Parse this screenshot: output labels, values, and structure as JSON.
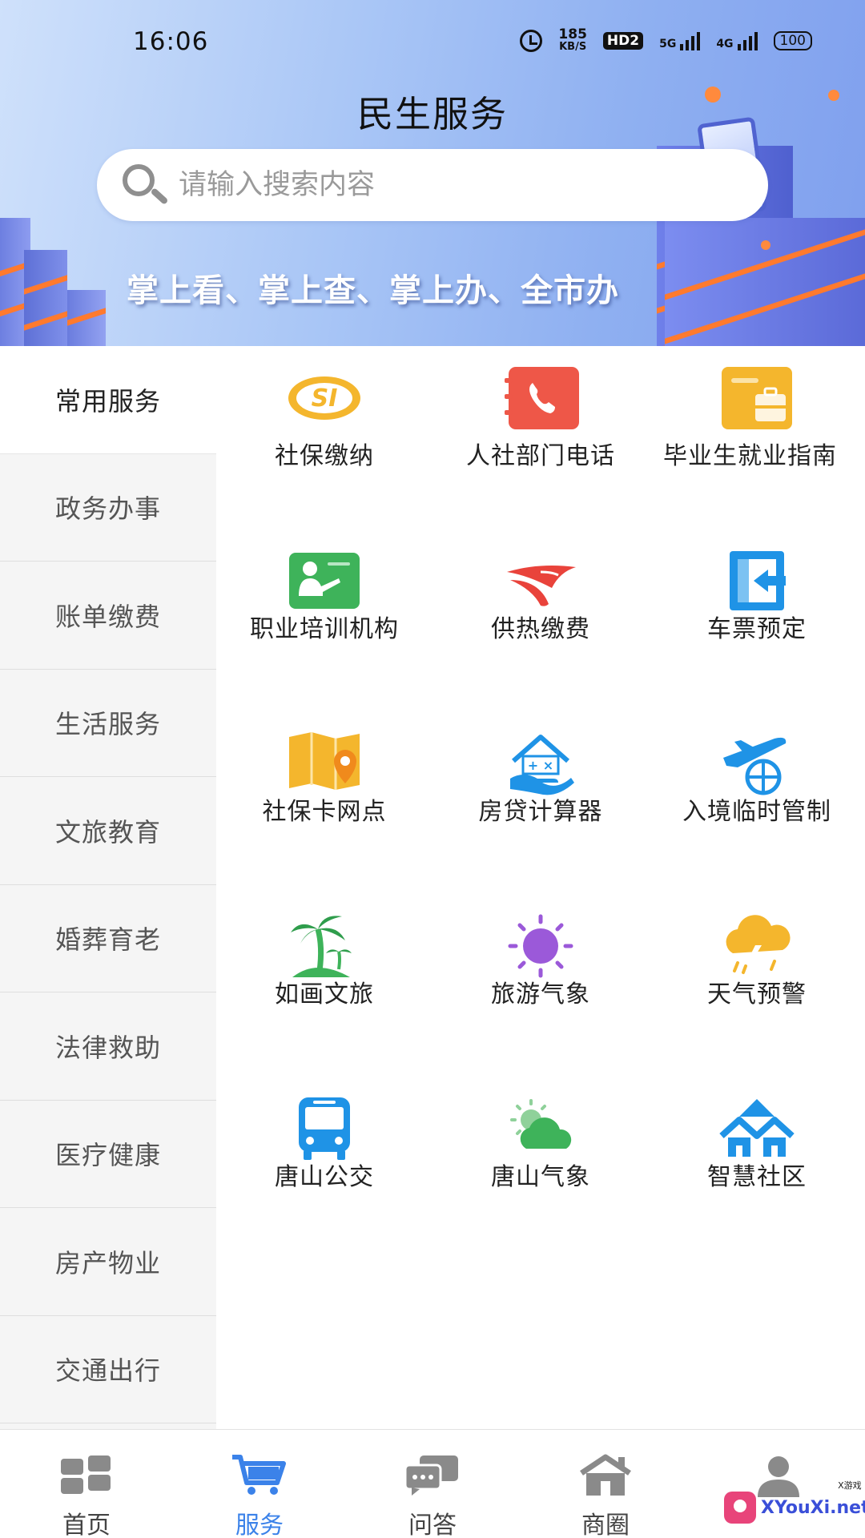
{
  "status_bar": {
    "time": "16:06",
    "speed_value": "185",
    "speed_unit": "KB/S",
    "hd_label": "HD2",
    "net1": "5G",
    "net2": "4G",
    "battery": "100"
  },
  "header": {
    "title": "民生服务",
    "search_placeholder": "请输入搜索内容",
    "slogan": "掌上看、掌上查、掌上办、全市办"
  },
  "sidebar": {
    "items": [
      {
        "label": "常用服务",
        "active": true
      },
      {
        "label": "政务办事"
      },
      {
        "label": "账单缴费"
      },
      {
        "label": "生活服务"
      },
      {
        "label": "文旅教育"
      },
      {
        "label": "婚葬育老"
      },
      {
        "label": "法律救助"
      },
      {
        "label": "医疗健康"
      },
      {
        "label": "房产物业"
      },
      {
        "label": "交通出行"
      }
    ]
  },
  "services": [
    {
      "label": "社保缴纳",
      "icon": "social-security-icon"
    },
    {
      "label": "人社部门电话",
      "icon": "phone-book-icon"
    },
    {
      "label": "毕业生就业指南",
      "icon": "briefcase-icon"
    },
    {
      "label": "职业培训机构",
      "icon": "training-icon"
    },
    {
      "label": "供热缴费",
      "icon": "heating-icon"
    },
    {
      "label": "车票预定",
      "icon": "ticket-icon"
    },
    {
      "label": "社保卡网点",
      "icon": "map-pin-icon"
    },
    {
      "label": "房贷计算器",
      "icon": "mortgage-calculator-icon"
    },
    {
      "label": "入境临时管制",
      "icon": "airplane-icon"
    },
    {
      "label": "如画文旅",
      "icon": "palm-tree-icon"
    },
    {
      "label": "旅游气象",
      "icon": "sun-icon"
    },
    {
      "label": "天气预警",
      "icon": "storm-cloud-icon"
    },
    {
      "label": "唐山公交",
      "icon": "bus-icon"
    },
    {
      "label": "唐山气象",
      "icon": "partly-cloudy-icon"
    },
    {
      "label": "智慧社区",
      "icon": "community-icon"
    }
  ],
  "tabbar": {
    "items": [
      {
        "label": "首页",
        "icon": "home-grid-icon"
      },
      {
        "label": "服务",
        "icon": "cart-icon",
        "active": true
      },
      {
        "label": "问答",
        "icon": "chat-icon"
      },
      {
        "label": "商圈",
        "icon": "shop-icon"
      },
      {
        "label": "",
        "icon": "user-icon"
      }
    ]
  },
  "watermark": {
    "text": "XYouXi.net",
    "sub": "X游戏"
  },
  "colors": {
    "accent": "#3b82e9",
    "sidebar_bg": "#f5f5f5",
    "banner": "#8fb0f1"
  }
}
